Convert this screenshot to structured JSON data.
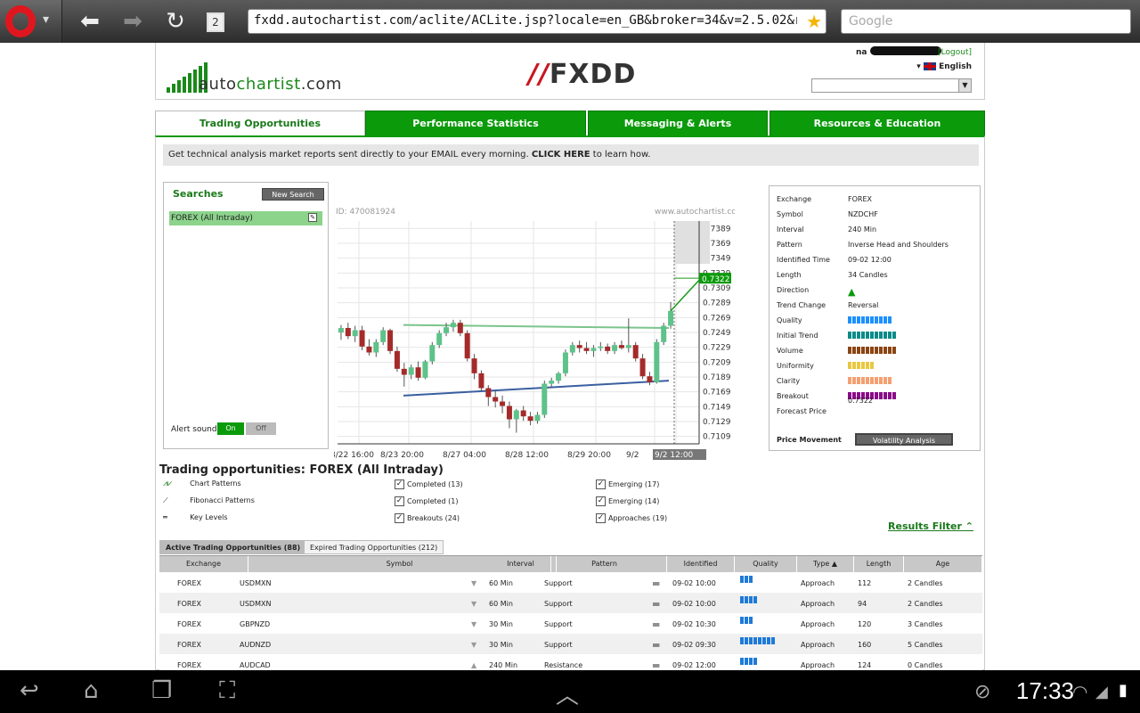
{
  "browser": {
    "url": "fxdd.autochartist.com/aclite/ACLite.jsp?locale=en_GB&broker=34&v=2.5.02&rm=1#Hom",
    "search_placeholder": "Google",
    "tab_count": "2"
  },
  "header": {
    "logo_text_1": "auto",
    "logo_text_2": "chartist",
    "logo_text_3": ".com",
    "broker_logo": "FXDD",
    "user_name": "na",
    "logout": "[Logout]",
    "language": "English"
  },
  "tabs": [
    "Trading Opportunities",
    "Performance Statistics",
    "Messaging & Alerts",
    "Resources & Education"
  ],
  "promo": {
    "text": "Get technical analysis market reports sent directly to your EMAIL every morning. ",
    "link": "CLICK HERE",
    "suffix": " to learn how."
  },
  "searches": {
    "title": "Searches",
    "new_search": "New Search",
    "item": "FOREX (All Intraday)",
    "alert_sound": "Alert sound",
    "on": "On",
    "off": "Off"
  },
  "chart_data": {
    "type": "candlestick",
    "id_label": "ID: 470081924",
    "watermark": "www.autochartist.com",
    "y_ticks": [
      "0.7389",
      "0.7369",
      "0.7349",
      "0.7329",
      "0.7309",
      "0.7289",
      "0.7269",
      "0.7249",
      "0.7229",
      "0.7209",
      "0.7189",
      "0.7169",
      "0.7149",
      "0.7129",
      "0.7109"
    ],
    "ylim": [
      0.7099,
      0.7399
    ],
    "x_ticks": [
      "8/22 16:00",
      "8/23 20:00",
      "8/27 04:00",
      "8/28 12:00",
      "8/29 20:00",
      "9/2",
      "9/2 12:00"
    ],
    "forecast_label": "0.7322",
    "candles": [
      [
        0.7249,
        0.7259,
        0.7239,
        0.7255
      ],
      [
        0.7255,
        0.7262,
        0.724,
        0.7244
      ],
      [
        0.7244,
        0.7258,
        0.7236,
        0.7252
      ],
      [
        0.7252,
        0.7258,
        0.7225,
        0.723
      ],
      [
        0.723,
        0.724,
        0.7218,
        0.7222
      ],
      [
        0.7222,
        0.724,
        0.7216,
        0.7236
      ],
      [
        0.7236,
        0.7256,
        0.7232,
        0.7252
      ],
      [
        0.7252,
        0.7254,
        0.722,
        0.7224
      ],
      [
        0.7224,
        0.723,
        0.7196,
        0.72
      ],
      [
        0.72,
        0.7208,
        0.7176,
        0.7192
      ],
      [
        0.7192,
        0.7206,
        0.7186,
        0.7202
      ],
      [
        0.7202,
        0.721,
        0.7184,
        0.7188
      ],
      [
        0.7188,
        0.7212,
        0.7186,
        0.721
      ],
      [
        0.721,
        0.7236,
        0.7206,
        0.7232
      ],
      [
        0.7232,
        0.7252,
        0.7228,
        0.7248
      ],
      [
        0.7248,
        0.7262,
        0.7244,
        0.7256
      ],
      [
        0.7256,
        0.7266,
        0.725,
        0.7262
      ],
      [
        0.7262,
        0.7266,
        0.7244,
        0.7248
      ],
      [
        0.7248,
        0.7252,
        0.721,
        0.7214
      ],
      [
        0.7214,
        0.722,
        0.7186,
        0.7194
      ],
      [
        0.7194,
        0.7198,
        0.717,
        0.7174
      ],
      [
        0.7174,
        0.7178,
        0.715,
        0.7162
      ],
      [
        0.7162,
        0.717,
        0.7148,
        0.7156
      ],
      [
        0.7156,
        0.7164,
        0.714,
        0.715
      ],
      [
        0.715,
        0.7156,
        0.712,
        0.7132
      ],
      [
        0.7132,
        0.7146,
        0.7114,
        0.7144
      ],
      [
        0.7144,
        0.715,
        0.713,
        0.7136
      ],
      [
        0.7136,
        0.7142,
        0.7124,
        0.713
      ],
      [
        0.713,
        0.7142,
        0.7126,
        0.7138
      ],
      [
        0.7138,
        0.7184,
        0.7134,
        0.718
      ],
      [
        0.718,
        0.7188,
        0.7174,
        0.7184
      ],
      [
        0.7184,
        0.7196,
        0.718,
        0.7194
      ],
      [
        0.7194,
        0.7226,
        0.719,
        0.7222
      ],
      [
        0.7222,
        0.7236,
        0.7218,
        0.7232
      ],
      [
        0.7232,
        0.7238,
        0.7222,
        0.7228
      ],
      [
        0.7228,
        0.7236,
        0.722,
        0.7224
      ],
      [
        0.7224,
        0.7232,
        0.7216,
        0.7228
      ],
      [
        0.7228,
        0.7236,
        0.7224,
        0.723
      ],
      [
        0.723,
        0.7234,
        0.722,
        0.7224
      ],
      [
        0.7224,
        0.7236,
        0.722,
        0.7232
      ],
      [
        0.7232,
        0.7238,
        0.7226,
        0.7228
      ],
      [
        0.7228,
        0.7268,
        0.7222,
        0.7232
      ],
      [
        0.7232,
        0.7236,
        0.721,
        0.7214
      ],
      [
        0.7214,
        0.722,
        0.7186,
        0.719
      ],
      [
        0.719,
        0.7196,
        0.7178,
        0.7182
      ],
      [
        0.7182,
        0.724,
        0.718,
        0.7236
      ],
      [
        0.7236,
        0.7262,
        0.7232,
        0.7258
      ],
      [
        0.7258,
        0.729,
        0.7254,
        0.7278
      ]
    ]
  },
  "details": {
    "rows": [
      {
        "label": "Exchange",
        "value": "FOREX"
      },
      {
        "label": "Symbol",
        "value": "NZDCHF"
      },
      {
        "label": "Interval",
        "value": "240 Min"
      },
      {
        "label": "Pattern",
        "value": "Inverse Head and Shoulders"
      },
      {
        "label": "Identified Time",
        "value": "09-02 12:00"
      },
      {
        "label": "Length",
        "value": "34 Candles"
      },
      {
        "label": "Direction",
        "value": ""
      },
      {
        "label": "Trend Change",
        "value": "Reversal"
      }
    ],
    "bars": [
      {
        "label": "Quality",
        "count": 10,
        "color": "#1e90ff"
      },
      {
        "label": "Initial Trend",
        "count": 11,
        "color": "#0b8a8a"
      },
      {
        "label": "Volume",
        "count": 11,
        "color": "#8b4513"
      },
      {
        "label": "Uniformity",
        "count": 6,
        "color": "#e8c840"
      },
      {
        "label": "Clarity",
        "count": 10,
        "color": "#f4a070"
      },
      {
        "label": "Breakout",
        "count": 11,
        "color": "#8a0a8a"
      }
    ],
    "forecast_label": "Forecast Price",
    "forecast_value": "0.7322",
    "price_movement": "Price Movement",
    "volatility": "Volatility Analysis"
  },
  "opportunities": {
    "title": "Trading opportunities: FOREX (All Intraday)",
    "types": [
      "Chart Patterns",
      "Fibonacci Patterns",
      "Key Levels"
    ],
    "col2": [
      "Completed (13)",
      "Completed (1)",
      "Breakouts (24)"
    ],
    "col3": [
      "Emerging (17)",
      "Emerging (14)",
      "Approaches (19)"
    ],
    "results_filter": "Results Filter",
    "tab_active": "Active Trading Opportunities (88)",
    "tab_expired": "Expired Trading Opportunities (212)",
    "headers": [
      "Exchange",
      "Symbol",
      "Interval",
      "Pattern",
      "Identified",
      "Quality",
      "Type",
      "Length",
      "Age"
    ],
    "rows": [
      {
        "exchange": "FOREX",
        "symbol": "USDMXN",
        "interval": "60 Min",
        "pattern": "Support",
        "identified": "09-02 10:00",
        "quality": 3,
        "type": "Approach",
        "length": "112",
        "age": "2 Candles",
        "dir": "down"
      },
      {
        "exchange": "FOREX",
        "symbol": "USDMXN",
        "interval": "60 Min",
        "pattern": "Support",
        "identified": "09-02 10:00",
        "quality": 4,
        "type": "Approach",
        "length": "94",
        "age": "2 Candles",
        "dir": "down"
      },
      {
        "exchange": "FOREX",
        "symbol": "GBPNZD",
        "interval": "30 Min",
        "pattern": "Support",
        "identified": "09-02 10:30",
        "quality": 3,
        "type": "Approach",
        "length": "120",
        "age": "3 Candles",
        "dir": "down"
      },
      {
        "exchange": "FOREX",
        "symbol": "AUDNZD",
        "interval": "30 Min",
        "pattern": "Support",
        "identified": "09-02 09:30",
        "quality": 8,
        "type": "Approach",
        "length": "160",
        "age": "5 Candles",
        "dir": "down"
      },
      {
        "exchange": "FOREX",
        "symbol": "AUDCAD",
        "interval": "240 Min",
        "pattern": "Resistance",
        "identified": "09-02 12:00",
        "quality": 4,
        "type": "Approach",
        "length": "124",
        "age": "0 Candles",
        "dir": "up"
      }
    ]
  },
  "status_bar": {
    "time": "17:33"
  }
}
